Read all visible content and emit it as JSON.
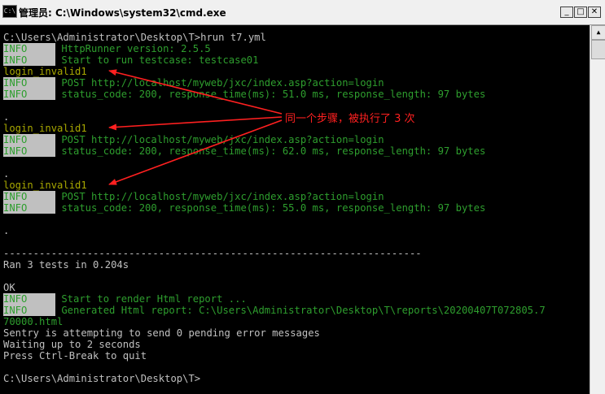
{
  "window": {
    "title": "管理员: C:\\Windows\\system32\\cmd.exe",
    "icon": "cmd-icon"
  },
  "controls": {
    "minimize": "_",
    "maximize": "□",
    "close": "✕"
  },
  "colors": {
    "info_text": "#2e9e2e",
    "info_bg": "#c0c0c0",
    "step": "#a8a800",
    "annotation": "#ff2020",
    "normal": "#c0c0c0"
  },
  "console": {
    "l01": "C:\\Users\\Administrator\\Desktop\\T>hrun t7.yml",
    "l02_tag": "INFO",
    "l02": " HttpRunner version: 2.5.5",
    "l03_tag": "INFO",
    "l03": " Start to run testcase: testcase01",
    "l04": "login_invalid1",
    "l05_tag": "INFO",
    "l05": " POST http://localhost/myweb/jxc/index.asp?action=login",
    "l06_tag": "INFO",
    "l06": " status_code: 200, response_time(ms): 51.0 ms, response_length: 97 bytes",
    "l07": ".",
    "l08": "login_invalid1",
    "l09_tag": "INFO",
    "l09": " POST http://localhost/myweb/jxc/index.asp?action=login",
    "l10_tag": "INFO",
    "l10": " status_code: 200, response_time(ms): 62.0 ms, response_length: 97 bytes",
    "l11": ".",
    "l12": "login_invalid1",
    "l13_tag": "INFO",
    "l13": " POST http://localhost/myweb/jxc/index.asp?action=login",
    "l14_tag": "INFO",
    "l14": " status_code: 200, response_time(ms): 55.0 ms, response_length: 97 bytes",
    "l15": ".",
    "l16": "----------------------------------------------------------------------",
    "l17": "Ran 3 tests in 0.204s",
    "l18": "OK",
    "l19_tag": "INFO",
    "l19": " Start to render Html report ...",
    "l20_tag": "INFO",
    "l20": " Generated Html report: C:\\Users\\Administrator\\Desktop\\T\\reports\\20200407T072805.7",
    "l21": "70000.html",
    "l22": "Sentry is attempting to send 0 pending error messages",
    "l23": "Waiting up to 2 seconds",
    "l24": "Press Ctrl-Break to quit",
    "l25": "C:\\Users\\Administrator\\Desktop\\T>"
  },
  "annotation": {
    "text": "同一个步骤，被执行了 3 次"
  }
}
